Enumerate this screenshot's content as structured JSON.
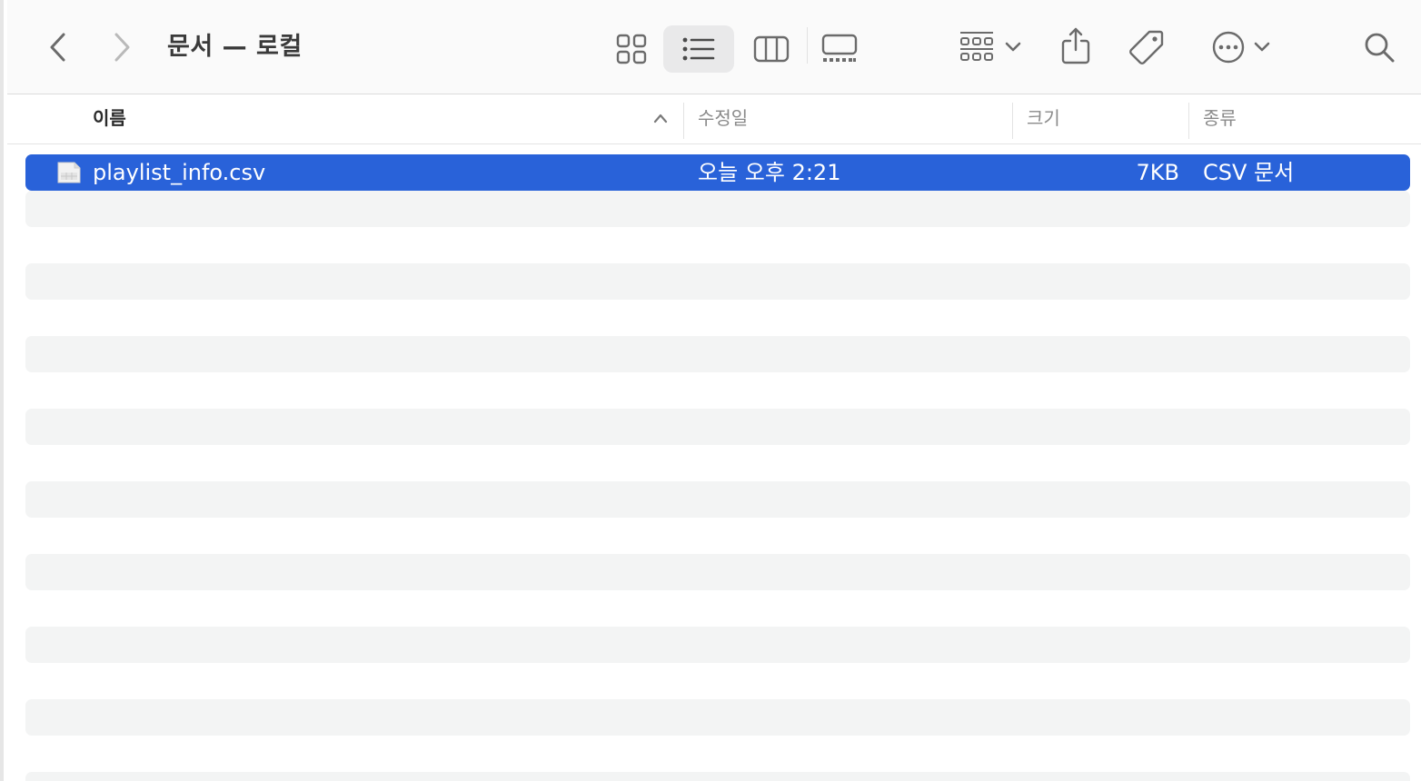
{
  "toolbar": {
    "title": "문서 — 로컬",
    "icons": {
      "back": "chevron-left-icon",
      "forward": "chevron-right-icon",
      "icon_view": "grid-view-icon",
      "list_view": "list-view-icon",
      "column_view": "column-view-icon",
      "gallery_view": "gallery-view-icon",
      "group": "group-by-icon",
      "share": "share-icon",
      "tag": "tag-icon",
      "more": "ellipsis-circle-icon",
      "search": "search-icon"
    }
  },
  "columns": {
    "name": "이름",
    "modified": "수정일",
    "size": "크기",
    "kind": "종류"
  },
  "files": [
    {
      "name": "playlist_info.csv",
      "modified": "오늘 오후 2:21",
      "size": "7KB",
      "kind": "CSV 문서",
      "selected": true
    }
  ],
  "colors": {
    "selection": "#2962d9",
    "stripe": "#f3f4f4",
    "toolbar_bg": "#fafafa"
  }
}
